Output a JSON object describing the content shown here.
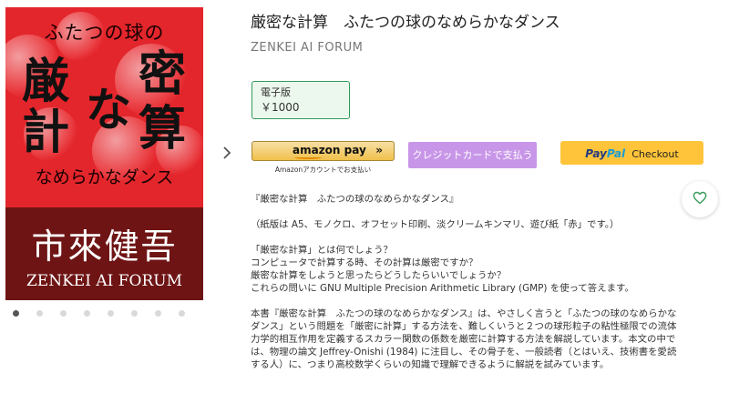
{
  "cover": {
    "subtitle_top": "ふたつの球の",
    "big_chars": [
      "厳",
      "密",
      "な",
      "計",
      "算"
    ],
    "subtitle_bottom": "なめらかなダンス",
    "author": "市來健吾",
    "publisher": "ZENKEI AI FORUM",
    "colors": {
      "top": "#e3262c",
      "bottom": "#6e1414"
    }
  },
  "gallery": {
    "next_icon": "chevron-right-icon",
    "dots_count": 8,
    "active_dot": 0
  },
  "product": {
    "title": "厳密な計算　ふたつの球のなめらかなダンス",
    "publisher": "ZENKEI AI FORUM",
    "price_label": "電子版",
    "price_value": "￥1000"
  },
  "payment": {
    "amazon_logo": "amazon pay",
    "amazon_arrows": "»",
    "amazon_caption": "Amazonアカウントでお支払い",
    "card_label": "クレジットカードで支払う",
    "paypal_pay": "Pay",
    "paypal_pal": "Pal",
    "paypal_checkout": "Checkout",
    "colors": {
      "amazon": "#f0c14b",
      "card": "#c896e8",
      "paypal": "#ffc439"
    }
  },
  "favorite": {
    "icon": "heart-icon",
    "color": "#3a9b5c"
  },
  "description": {
    "p1": "『厳密な計算　ふたつの球のなめらかなダンス』",
    "p2": "（紙版は A5、モノクロ、オフセット印刷、淡クリームキンマリ、遊び紙「赤」です。）",
    "p3": [
      "「厳密な計算」とは何でしょう？",
      "コンピュータで計算する時、その計算は厳密ですか？",
      "厳密な計算をしようと思ったらどうしたらいいでしょうか？",
      "これらの問いに GNU Multiple Precision Arithmetic Library (GMP) を使って答えます。"
    ],
    "p4": "本書『厳密な計算　ふたつの球のなめらかなダンス』は、やさしく言うと「ふたつの球のなめらかなダンス」という問題を「厳密に計算」する方法を、難しくいうと２つの球形粒子の粘性極限での流体力学的相互作用を定義するスカラー関数の係数を厳密に計算する方法を解説しています。本文の中では、物理の論文 Jeffrey-Onishi (1984) に注目し、その骨子を、一般読者（とはいえ、技術書を愛読する人）に、つまり高校数学くらいの知識で理解できるように解説を試みています。"
  }
}
